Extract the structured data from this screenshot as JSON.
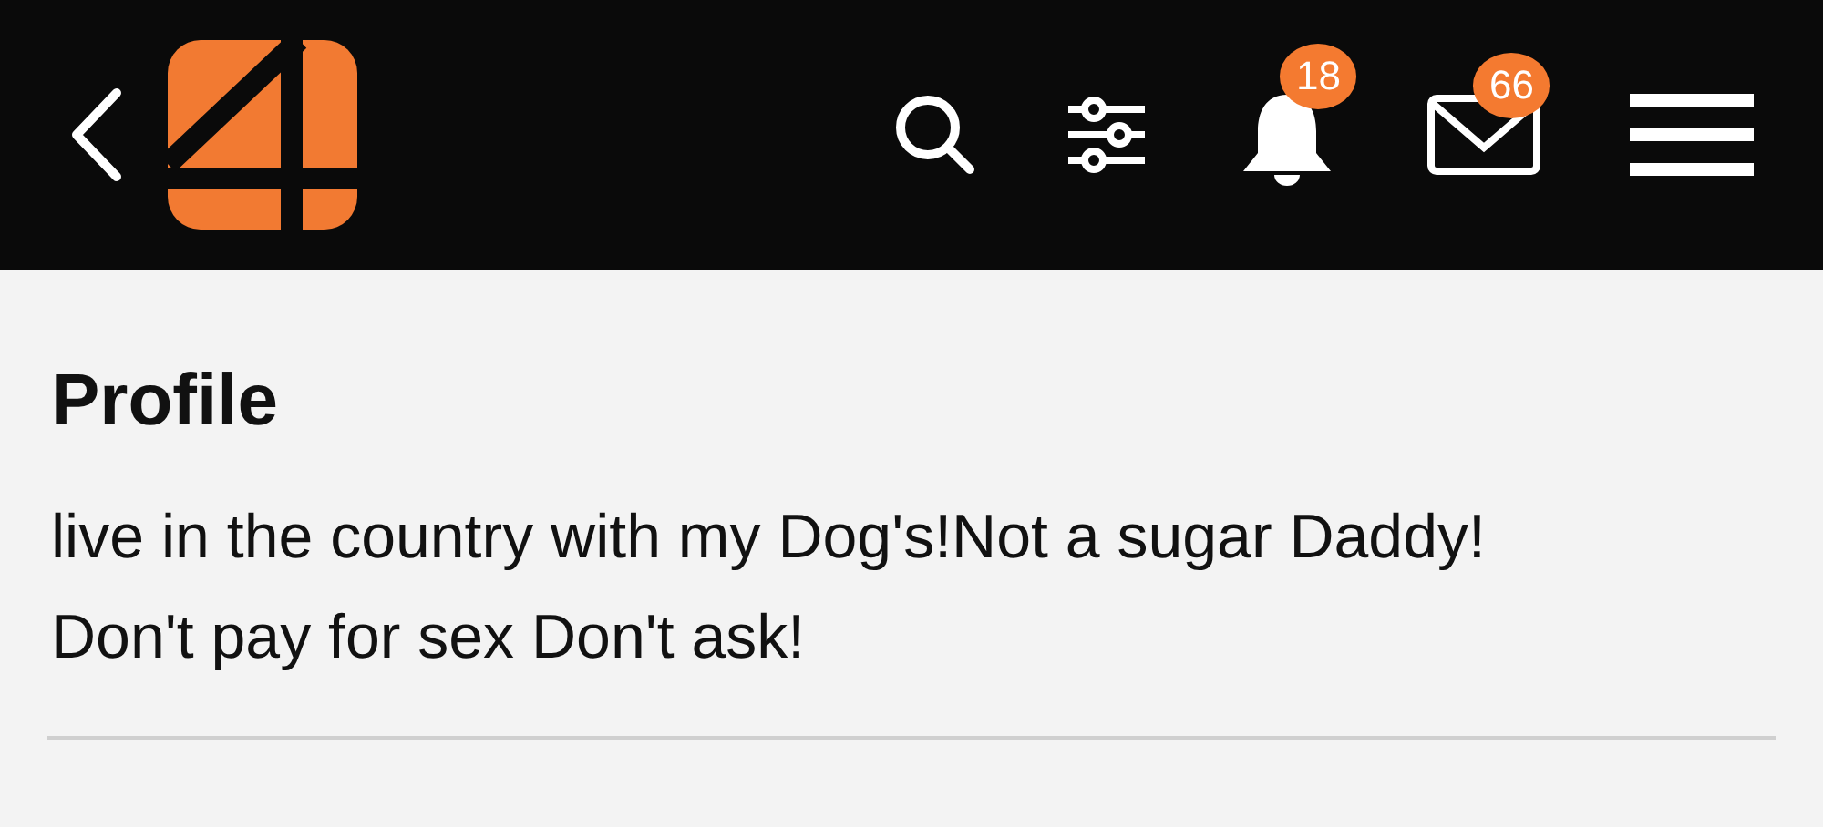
{
  "header": {
    "notifications_badge": "18",
    "messages_badge": "66"
  },
  "profile": {
    "title": "Profile",
    "bio": "live in the country with my Dog's!Not a sugar Daddy! Don't pay for sex Don't ask!"
  }
}
